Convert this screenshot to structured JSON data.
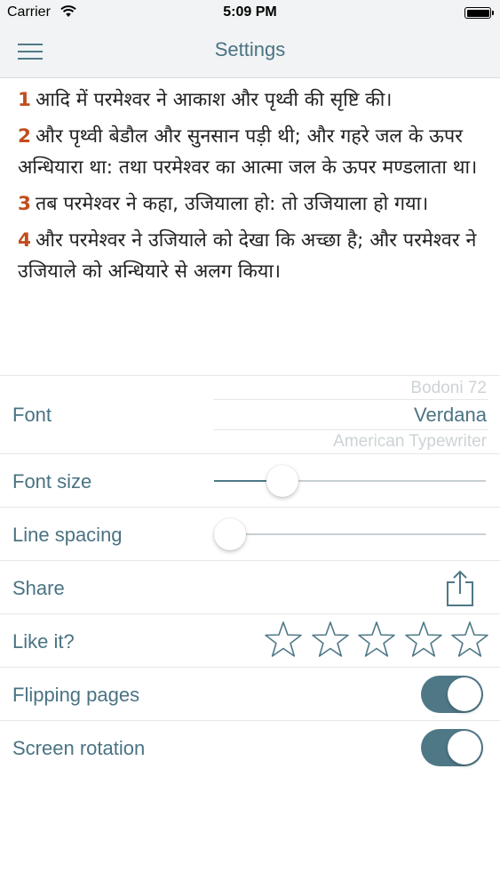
{
  "status_bar": {
    "carrier": "Carrier",
    "time": "5:09 PM",
    "wifi_icon": "wifi-icon",
    "battery_icon": "battery-icon"
  },
  "nav": {
    "title": "Settings",
    "menu_icon": "hamburger-menu-icon"
  },
  "verses": [
    {
      "number": "1",
      "text": "आदि में परमेश्वर ने आकाश और पृथ्वी की सृष्टि की।"
    },
    {
      "number": "2",
      "text": "और पृथ्वी बेडौल और सुनसान पड़ी थी; और गहरे जल के ऊपर अन्धियारा था: तथा परमेश्वर का आत्मा जल के ऊपर मण्डलाता था।"
    },
    {
      "number": "3",
      "text": "तब परमेश्वर ने कहा, उजियाला हो: तो उजियाला हो गया।"
    },
    {
      "number": "4",
      "text": "और परमेश्वर ने उजियाले को देखा कि अच्छा है; और परमेश्वर ने उजियाले को अन्धियारे से अलग किया।"
    }
  ],
  "settings": {
    "font": {
      "label": "Font",
      "options_visible": [
        "Bodoni 72",
        "Verdana",
        "American Typewriter"
      ],
      "selected": "Verdana"
    },
    "font_size": {
      "label": "Font size",
      "value_fraction": 0.25
    },
    "line_spacing": {
      "label": "Line spacing",
      "value_fraction": 0.06
    },
    "share": {
      "label": "Share",
      "icon": "share-icon"
    },
    "like": {
      "label": "Like it?",
      "stars_total": 5,
      "stars_filled": 0,
      "icon": "star-icon"
    },
    "flipping_pages": {
      "label": "Flipping pages",
      "on": true
    },
    "screen_rotation": {
      "label": "Screen rotation",
      "on": true
    }
  },
  "colors": {
    "accent": "#4f7887",
    "label_text": "#4a7383",
    "verse_number": "#c24d1e",
    "bar_background": "#f1f3f4"
  }
}
